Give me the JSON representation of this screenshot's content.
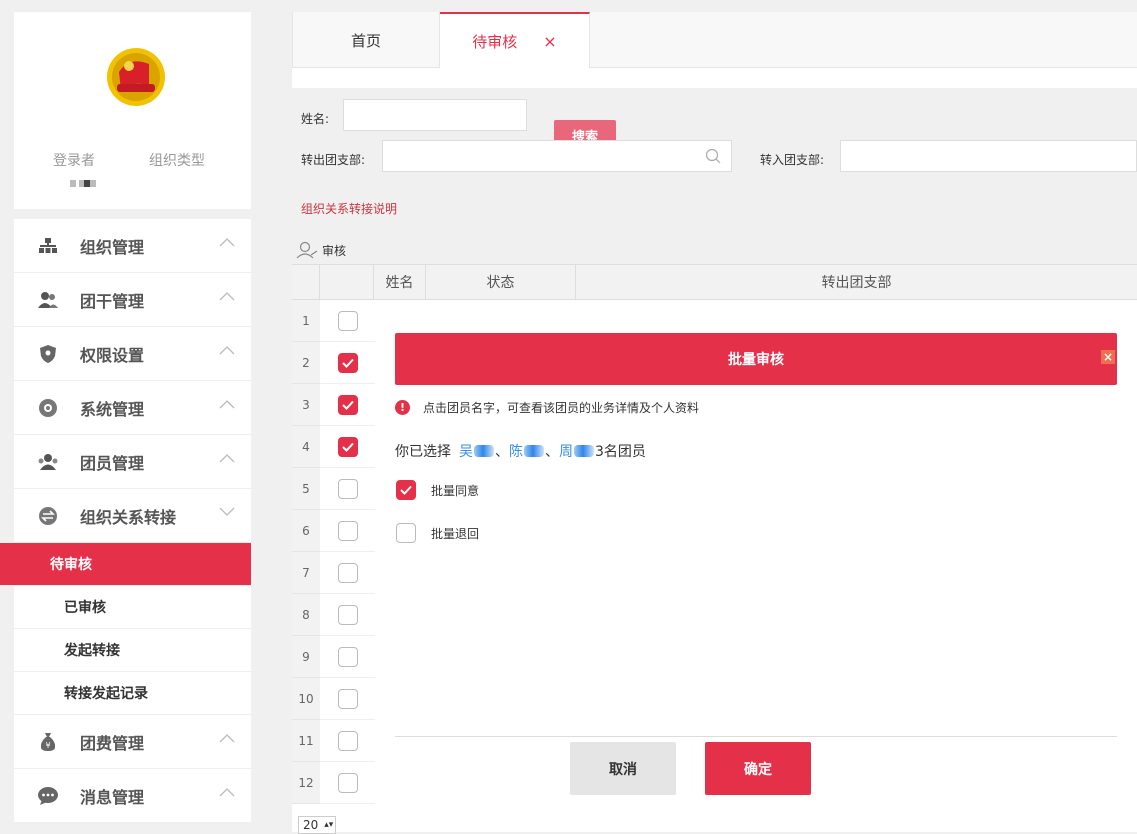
{
  "sidebar": {
    "user_label": "登录者",
    "org_type_label": "组织类型",
    "menu": [
      {
        "label": "组织管理",
        "icon": "org-tree-icon"
      },
      {
        "label": "团干管理",
        "icon": "users-icon"
      },
      {
        "label": "权限设置",
        "icon": "shield-icon"
      },
      {
        "label": "系统管理",
        "icon": "gear-icon"
      },
      {
        "label": "团员管理",
        "icon": "members-icon"
      },
      {
        "label": "组织关系转接",
        "icon": "transfer-icon"
      }
    ],
    "submenu": [
      "待审核",
      "已审核",
      "发起转接",
      "转接发起记录"
    ],
    "menu_after": [
      {
        "label": "团费管理",
        "icon": "money-bag-icon"
      },
      {
        "label": "消息管理",
        "icon": "chat-icon"
      }
    ]
  },
  "tabs": {
    "home": "首页",
    "active": "待审核",
    "close": "×"
  },
  "filters": {
    "name_label": "姓名:",
    "search_button": "搜索",
    "out_branch_label": "转出团支部:",
    "in_branch_label": "转入团支部:",
    "transfer_note": "组织关系转接说明",
    "review_label": "审核"
  },
  "grid": {
    "headers": [
      "姓名",
      "状态",
      "转出团支部"
    ],
    "rows": [
      {
        "num": "1",
        "checked": false
      },
      {
        "num": "2",
        "checked": true
      },
      {
        "num": "3",
        "checked": true
      },
      {
        "num": "4",
        "checked": true
      },
      {
        "num": "5",
        "checked": false
      },
      {
        "num": "6",
        "checked": false
      },
      {
        "num": "7",
        "checked": false
      },
      {
        "num": "8",
        "checked": false
      },
      {
        "num": "9",
        "checked": false
      },
      {
        "num": "10",
        "checked": false
      },
      {
        "num": "11",
        "checked": false
      },
      {
        "num": "12",
        "checked": false
      }
    ],
    "page_size": "20"
  },
  "modal": {
    "title": "批量审核",
    "close": "×",
    "tip": "点击团员名字，可查看该团员的业务详情及个人资料",
    "selected_prefix": "你已选择",
    "names": [
      "吴",
      "陈",
      "周"
    ],
    "sep": "、",
    "selected_suffix": "3名团员",
    "approve_label": "批量同意",
    "return_label": "批量退回",
    "cancel": "取消",
    "confirm": "确定"
  },
  "colors": {
    "accent": "#e5304a",
    "link": "#3a8ee6"
  }
}
